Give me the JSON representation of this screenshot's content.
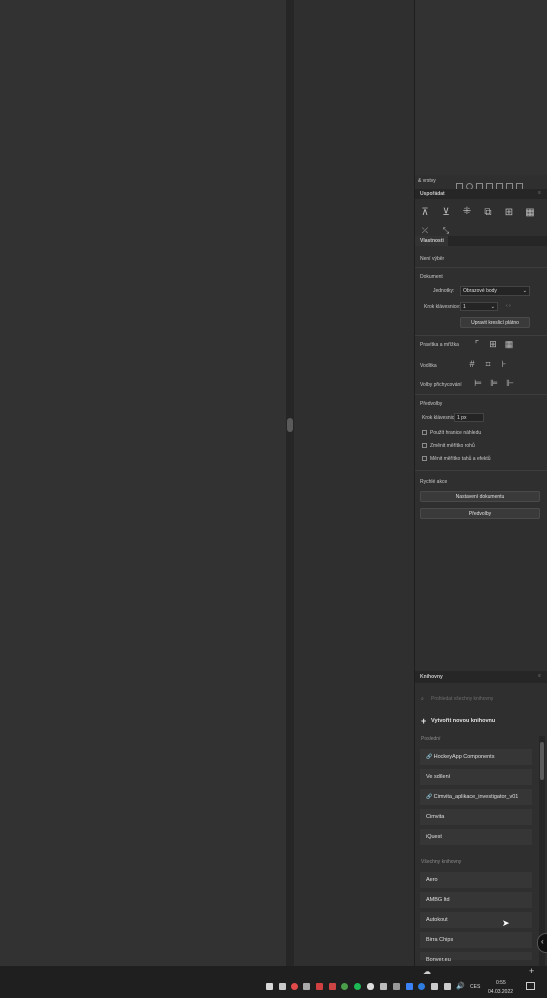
{
  "top_panel": {
    "title": "& vrstvy"
  },
  "align": {
    "title": "Uspořádat"
  },
  "properties": {
    "title": "Vlastnosti",
    "no_selection": "Není výběr",
    "document_label": "Dokument",
    "units_label": "Jednotky:",
    "units_value": "Obrazové body",
    "grid_label": "Krok klávesnice:",
    "grid_value": "1",
    "edit_artboards_button": "Upravit kreslicí plátno",
    "rulers_label": "Pravítka a mřížka",
    "guides_label": "Vodítka",
    "snap_label": "Volby přichycování",
    "preferences_label": "Předvolby",
    "keyboard_increment_label": "Krok klávesnice:",
    "keyboard_increment_value": "1 px",
    "checkbox_1": "Použít hranice náhledu",
    "checkbox_2": "Změnit měřítko rohů",
    "checkbox_3": "Měnit měřítko tahů a efektů",
    "quick_actions_label": "Rychlé akce",
    "doc_settings_button": "Nastavení dokumentu",
    "prefs_button": "Předvolby"
  },
  "libraries": {
    "title": "Knihovny",
    "search_placeholder": "Prohledat všechny knihovny",
    "create_button": "Vytvořit novou knihovnu",
    "recent_label": "Poslední",
    "recent": [
      "HockeyApp Components",
      "Ve sdílení",
      "Cimvita_aplikace_investigator_v01",
      "Cimvita",
      "iQuest"
    ],
    "recent_linked": [
      true,
      false,
      true,
      false,
      false
    ],
    "all_label": "Všechny knihovny",
    "all": [
      "Aero",
      "AMBG ltd",
      "Autokout",
      "Birra Chips",
      "Bonver.eu"
    ]
  },
  "taskbar": {
    "lang": "CES",
    "time": "0:55",
    "date": "04.03.2022"
  },
  "colors": {
    "accent": "#e24a4a",
    "bg": "#2b2b2b",
    "panel": "#2f2f2f"
  }
}
